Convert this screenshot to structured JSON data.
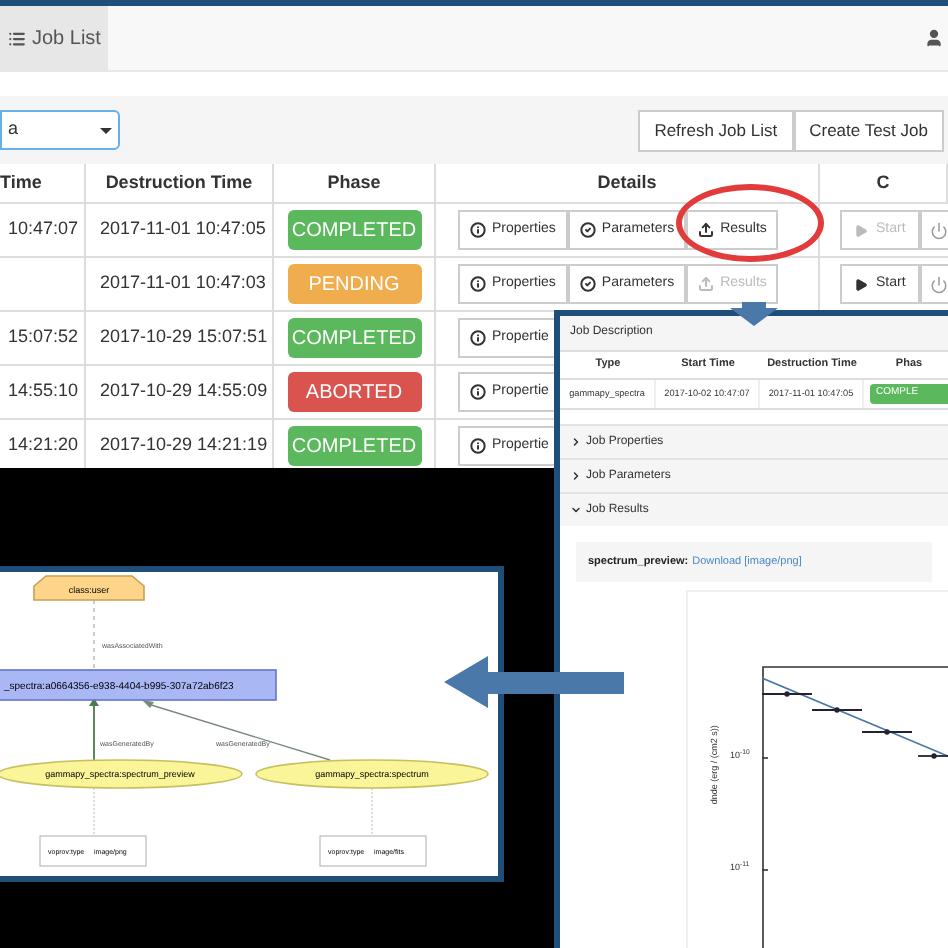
{
  "navbar": {
    "tabs": [
      {
        "label": "Job List",
        "selected": true
      }
    ]
  },
  "filter": {
    "value": "a"
  },
  "toolbar_buttons": [
    "Refresh Job List",
    "Create Test Job"
  ],
  "table": {
    "columns": [
      "Time",
      "Destruction Time",
      "Phase",
      "Details",
      "C"
    ],
    "rows": [
      {
        "time": "10:47:07",
        "destruction": "2017-11-01 10:47:05",
        "phase": {
          "label": "COMPLETED",
          "kind": "completed"
        },
        "details": [
          {
            "label": "Properties",
            "disabled": false
          },
          {
            "label": "Parameters",
            "disabled": false
          },
          {
            "label": "Results",
            "disabled": false
          }
        ],
        "control": {
          "label": "Start",
          "disabled": true
        }
      },
      {
        "destruction": "2017-11-01 10:47:03",
        "phase": {
          "label": "PENDING",
          "kind": "pending"
        },
        "details": [
          {
            "label": "Properties",
            "disabled": false
          },
          {
            "label": "Parameters",
            "disabled": false
          },
          {
            "label": "Results",
            "disabled": true
          }
        ],
        "control": {
          "label": "Start",
          "disabled": false
        }
      },
      {
        "time": "15:07:52",
        "destruction": "2017-10-29 15:07:51",
        "phase": {
          "label": "COMPLETED",
          "kind": "completed"
        },
        "details": [
          {
            "label": "Propertie",
            "disabled": false
          }
        ]
      },
      {
        "time": "14:55:10",
        "destruction": "2017-10-29 14:55:09",
        "phase": {
          "label": "ABORTED",
          "kind": "aborted"
        },
        "details": [
          {
            "label": "Propertie",
            "disabled": false
          }
        ]
      },
      {
        "time": "14:21:20",
        "destruction": "2017-10-29 14:21:19",
        "phase": {
          "label": "COMPLETED",
          "kind": "completed"
        },
        "details": [
          {
            "label": "Propertie",
            "disabled": false
          }
        ]
      }
    ]
  },
  "job_panel": {
    "title": "Job Description",
    "columns": [
      "Type",
      "Start Time",
      "Destruction Time",
      "Phas"
    ],
    "row": [
      "gammapy_spectra",
      "2017-10-02 10:47:07",
      "2017-11-01 10:47:05"
    ],
    "phase": {
      "label": "COMPLE",
      "kind": "completed"
    },
    "sections": [
      {
        "label": "Job Properties",
        "expanded": false
      },
      {
        "label": "Job Parameters",
        "expanded": false
      },
      {
        "label": "Job Results",
        "expanded": true
      }
    ],
    "result": {
      "name": "spectrum_preview:",
      "link": "Download [image/png]"
    },
    "plot": {
      "ylabel": "dnde (erg / (cm2 s))",
      "yticks": [
        "10$^{-10}$",
        "10$^{-11}$"
      ]
    }
  },
  "provenance_graph": {
    "nodes": [
      {
        "label": "class:user",
        "kind": "agent"
      },
      {
        "label": "_spectra:a0664356-e938-4404-b995-307a72ab6f23",
        "kind": "activity"
      },
      {
        "label": "gammapy_spectra:spectrum_preview",
        "kind": "entity"
      },
      {
        "label": "gammapy_spectra:spectrum",
        "kind": "entity"
      }
    ],
    "edges": [
      "wasAssociatedWith",
      "wasGeneratedBy",
      "wasGeneratedBy"
    ],
    "notes": [
      {
        "key": "voprov:type",
        "value": "image/png"
      },
      {
        "key": "voprov:type",
        "value": "image/fits"
      }
    ]
  }
}
